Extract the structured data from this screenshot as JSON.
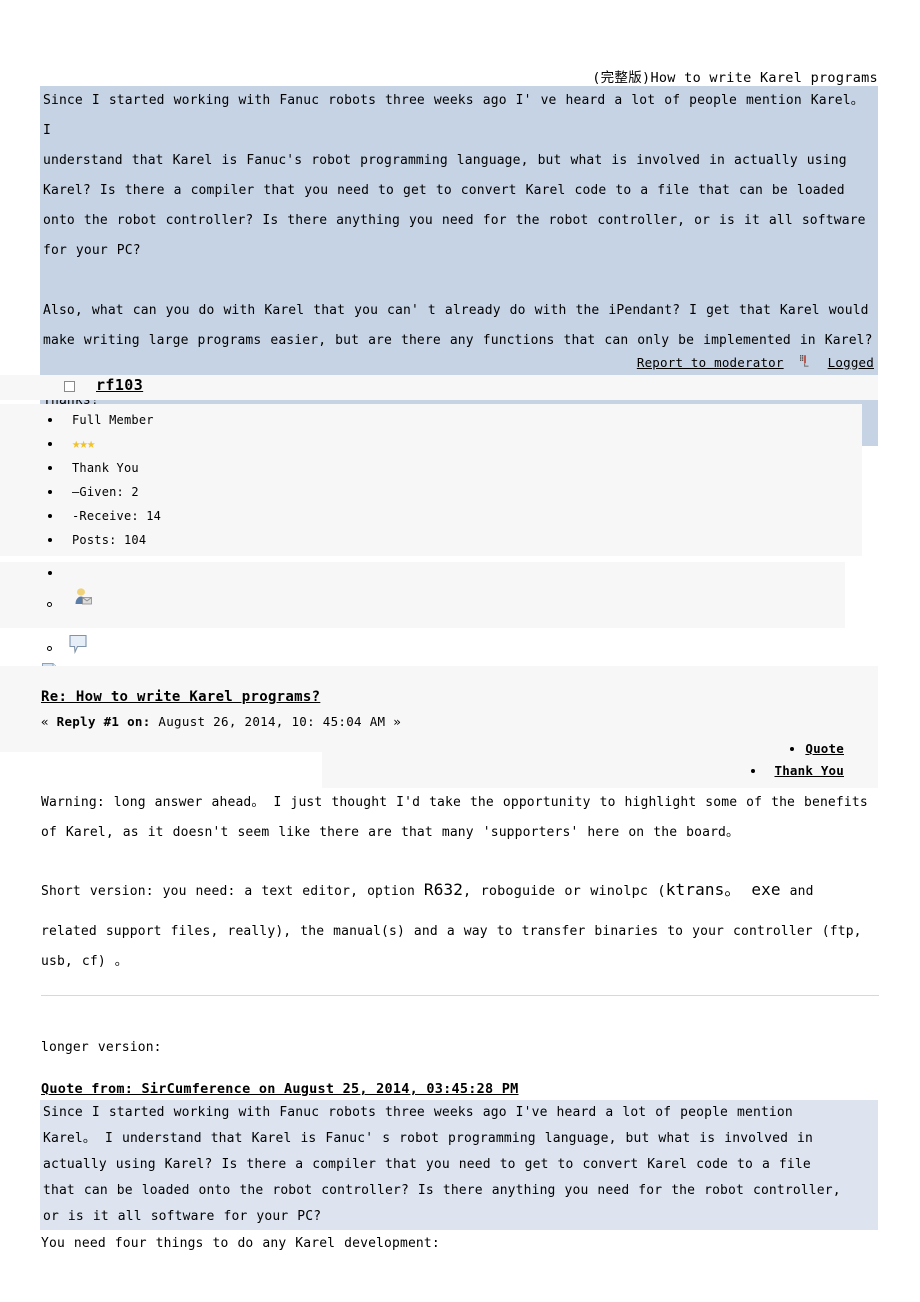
{
  "document": {
    "header_title": "(完整版)How to write Karel programs"
  },
  "original_post": {
    "paragraphs": [
      "Since I started working with Fanuc robots three weeks ago I' ve heard a lot of people mention Karel。 I",
      "understand that Karel is Fanuc's robot programming language,  but what is involved in actually using",
      "Karel? Is there a compiler that you need to get to convert Karel code to a file that can be loaded",
      "onto the robot controller? Is there anything you need for the robot controller,  or is it all software",
      "for your PC?"
    ],
    "paragraph2": [
      "Also, what can you do with Karel that you can' t already do with the iPendant? I get that Karel would",
      "make writing large programs easier,  but are there any functions that can only be implemented in Karel?"
    ],
    "closing": "Thanks!",
    "footer": {
      "report_label": "Report to moderator",
      "logged_label": "Logged",
      "logged_icon": "logged-icon"
    }
  },
  "user": {
    "checkbox_icon": "checkbox-icon",
    "name": "rf103",
    "stats": [
      {
        "label": "Full Member",
        "type": "text"
      },
      {
        "label": "★★★",
        "type": "stars"
      },
      {
        "label": "Thank You",
        "type": "text"
      },
      {
        "label": "—Given: 2",
        "type": "text"
      },
      {
        "label": "-Receive: 14",
        "type": "text"
      },
      {
        "label": "Posts:  104",
        "type": "text"
      }
    ],
    "icons": [
      {
        "name": "person-email-icon"
      },
      {
        "name": "speech-bubble-icon"
      },
      {
        "name": "page-icon"
      }
    ]
  },
  "reply": {
    "title": "Re: How to write Karel programs?",
    "meta_prefix": "«",
    "meta_label": "Reply #1 on:",
    "meta_date": "August 26,  2014, 10: 45:04 AM",
    "meta_suffix": "»",
    "actions": {
      "quote_label": "Quote",
      "thank_you_label": "Thank You"
    },
    "body": {
      "warning_lines": [
        "Warning: long answer ahead。 I just thought I'd take the opportunity to highlight some of the benefits",
        "of Karel, as it doesn't seem like there are that many 'supporters'  here on the board。"
      ],
      "short_version_parts": {
        "lead": "Short version: you need: a text editor, option ",
        "option_code": "R632",
        "mid": ", roboguide or winolpc (",
        "ktrans": "ktrans。 exe",
        "tail": " and"
      },
      "short_version_rest": [
        "related support files, really),  the manual(s)  and a way to transfer binaries to your controller (ftp,",
        "usb, cf) 。"
      ],
      "longer_version_label": "longer version:"
    }
  },
  "nested_quote": {
    "header": "Quote from:  SirCumference on August 25,  2014, 03:45:28 PM",
    "lines": [
      "Since I started working with Fanuc robots three weeks ago I've heard a lot of people mention",
      "Karel。 I understand that Karel is Fanuc' s robot programming language, but what is involved in",
      "actually using Karel? Is there a compiler that you need to get to convert Karel code to a file",
      "that can be loaded onto the robot controller? Is there anything you need for the robot controller,",
      "or is it all software for your PC?"
    ]
  },
  "tail": {
    "line": "You need four things to do any Karel development:"
  },
  "colors": {
    "quote_blue": "#c6d3e4",
    "nested_quote_blue": "#dde4ef",
    "panel_grey": "#f7f7f7",
    "star_gold": "#f0c22a"
  }
}
